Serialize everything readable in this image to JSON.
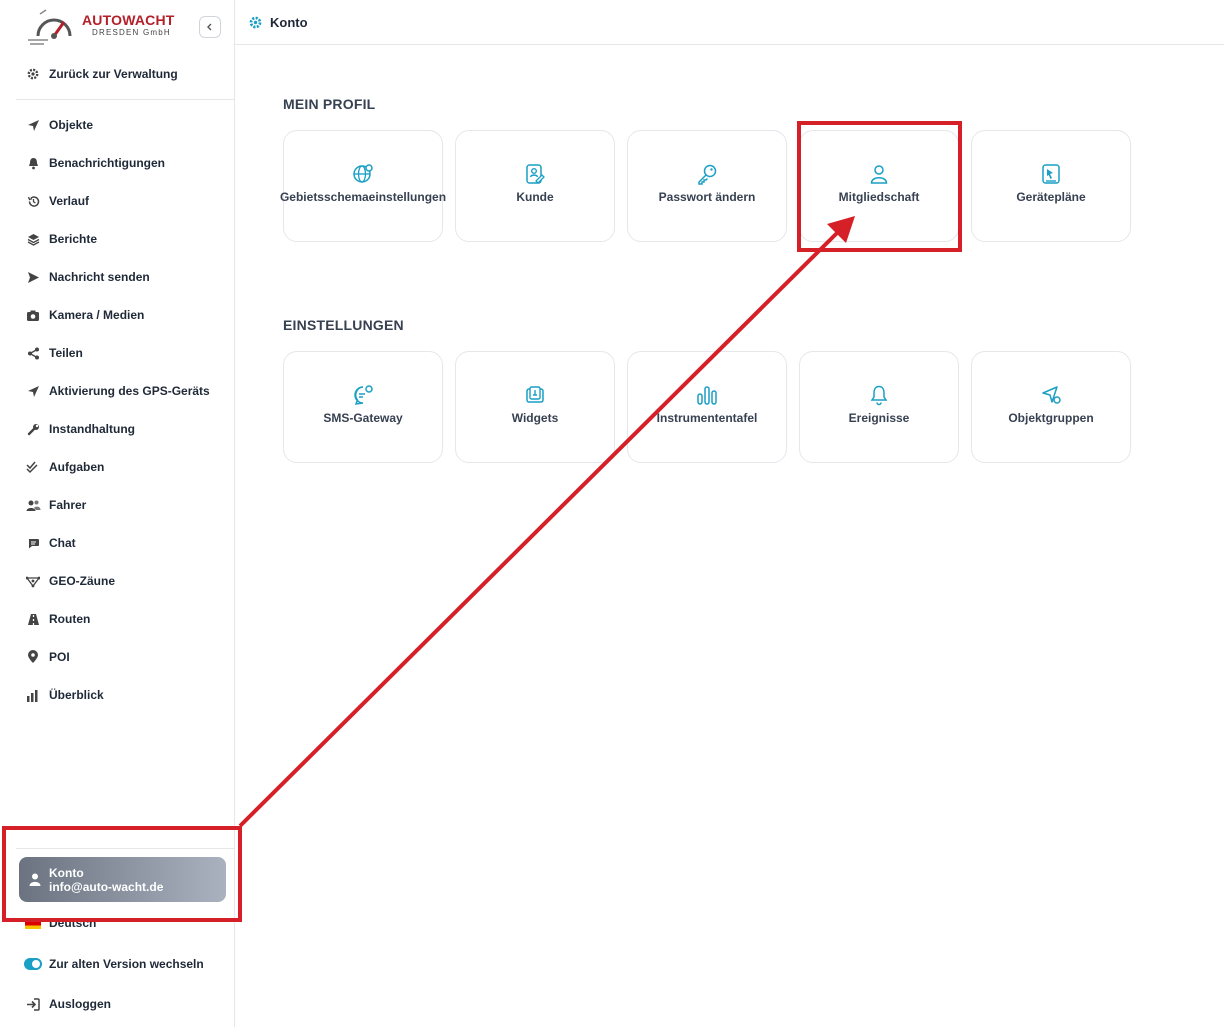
{
  "logo": {
    "brand": "AUTOWACHT",
    "sub": "DRESDEN GmbH"
  },
  "sidebar": {
    "back_label": "Zurück zur Verwaltung",
    "items": [
      {
        "label": "Objekte",
        "icon": "navigation-arrow-icon"
      },
      {
        "label": "Benachrichtigungen",
        "icon": "bell-icon"
      },
      {
        "label": "Verlauf",
        "icon": "history-icon"
      },
      {
        "label": "Berichte",
        "icon": "layers-icon"
      },
      {
        "label": "Nachricht senden",
        "icon": "send-icon"
      },
      {
        "label": "Kamera / Medien",
        "icon": "camera-icon"
      },
      {
        "label": "Teilen",
        "icon": "share-icon"
      },
      {
        "label": "Aktivierung des GPS-Geräts",
        "icon": "navigation-arrow-icon"
      },
      {
        "label": "Instandhaltung",
        "icon": "wrench-icon"
      },
      {
        "label": "Aufgaben",
        "icon": "double-check-icon"
      },
      {
        "label": "Fahrer",
        "icon": "users-icon"
      },
      {
        "label": "Chat",
        "icon": "chat-icon"
      },
      {
        "label": "GEO-Zäune",
        "icon": "geofence-icon"
      },
      {
        "label": "Routen",
        "icon": "road-icon"
      },
      {
        "label": "POI",
        "icon": "map-pin-icon"
      },
      {
        "label": "Überblick",
        "icon": "bar-chart-icon"
      }
    ],
    "account": {
      "title": "Konto",
      "email": "info@auto-wacht.de"
    },
    "language": "Deutsch",
    "old_version_label": "Zur alten Version wechseln",
    "logout_label": "Ausloggen"
  },
  "header": {
    "title": "Konto"
  },
  "main": {
    "profile": {
      "title": "MEIN PROFIL",
      "tiles": [
        {
          "label": "Gebietsschemaeinstellungen",
          "icon": "globe-settings-icon"
        },
        {
          "label": "Kunde",
          "icon": "customer-card-icon"
        },
        {
          "label": "Passwort ändern",
          "icon": "key-icon"
        },
        {
          "label": "Mitgliedschaft",
          "icon": "user-icon"
        },
        {
          "label": "Gerätepläne",
          "icon": "device-plan-icon"
        }
      ]
    },
    "settings": {
      "title": "EINSTELLUNGEN",
      "tiles": [
        {
          "label": "SMS-Gateway",
          "icon": "message-settings-icon"
        },
        {
          "label": "Widgets",
          "icon": "widget-icon"
        },
        {
          "label": "Instrumententafel",
          "icon": "bars-icon"
        },
        {
          "label": "Ereignisse",
          "icon": "bell-icon"
        },
        {
          "label": "Objektgruppen",
          "icon": "navigation-settings-icon"
        }
      ]
    }
  },
  "colors": {
    "accent": "#1a9fc5",
    "annotation": "#d62027",
    "brand": "#b3202a"
  }
}
